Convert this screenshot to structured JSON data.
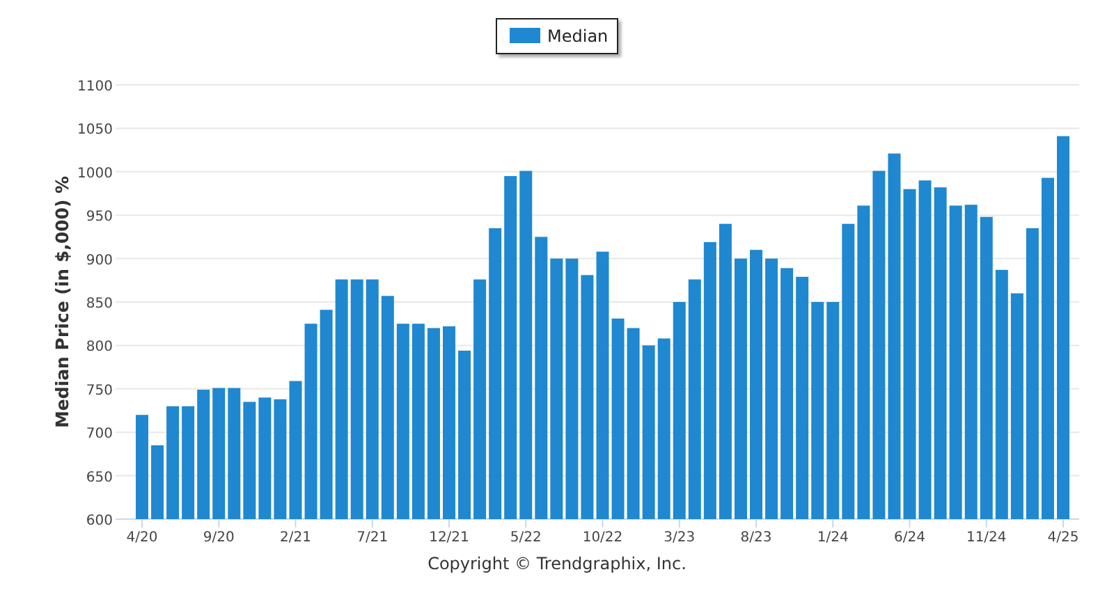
{
  "chart_data": {
    "type": "bar",
    "ylabel": "Median Price (in $,000) %",
    "grid": true,
    "categories": [
      "4/20",
      null,
      null,
      null,
      null,
      "9/20",
      null,
      null,
      null,
      null,
      "2/21",
      null,
      null,
      null,
      null,
      "7/21",
      null,
      null,
      null,
      null,
      "12/21",
      null,
      null,
      null,
      null,
      "5/22",
      null,
      null,
      null,
      null,
      "10/22",
      null,
      null,
      null,
      null,
      "3/23",
      null,
      null,
      null,
      null,
      "8/23",
      null,
      null,
      null,
      null,
      "1/24",
      null,
      null,
      null,
      null,
      "6/24",
      null,
      null,
      null,
      null,
      "11/24",
      null,
      null,
      null,
      null,
      "4/25"
    ],
    "series": [
      {
        "name": "Median",
        "color": "#1f88d0",
        "values": [
          720,
          685,
          730,
          730,
          749,
          751,
          751,
          735,
          740,
          738,
          759,
          825,
          841,
          876,
          876,
          876,
          857,
          825,
          825,
          820,
          822,
          794,
          876,
          935,
          995,
          1001,
          925,
          900,
          900,
          881,
          908,
          831,
          820,
          800,
          808,
          850,
          876,
          919,
          940,
          900,
          910,
          900,
          889,
          879,
          850,
          850,
          940,
          961,
          1001,
          1021,
          980,
          990,
          982,
          961,
          962,
          948,
          887,
          860,
          935,
          993,
          1041
        ]
      }
    ],
    "ylim": [
      600,
      1100
    ],
    "yticks": [
      600,
      650,
      700,
      750,
      800,
      850,
      900,
      950,
      1000,
      1050,
      1100
    ]
  },
  "copyright": "Copyright © Trendgraphix, Inc."
}
